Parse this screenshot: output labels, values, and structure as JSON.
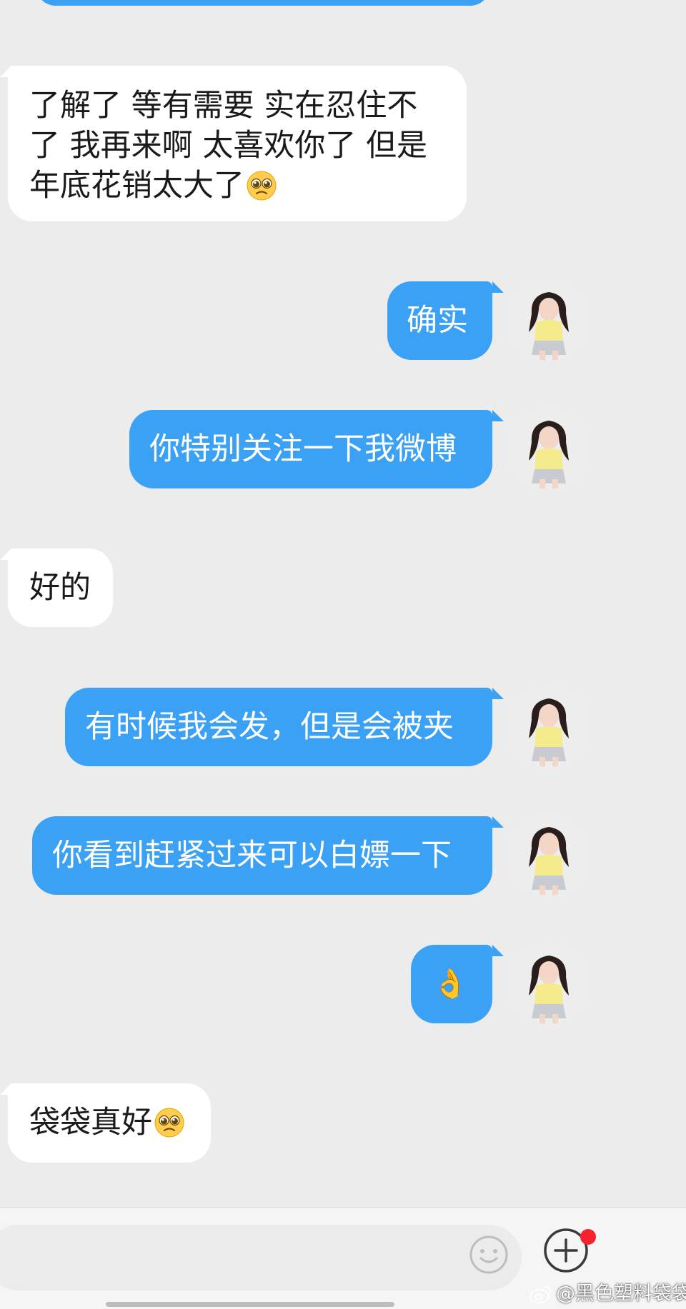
{
  "messages": [
    {
      "side": "incoming",
      "text": "了解了 等有需要 实在忍住不了 我再来啊 太喜欢你了 但是年底花销太大了",
      "emoji": "pleading-face"
    },
    {
      "side": "outgoing",
      "text": "确实"
    },
    {
      "side": "outgoing",
      "text": "你特别关注一下我微博"
    },
    {
      "side": "incoming",
      "text": "好的"
    },
    {
      "side": "outgoing",
      "text": "有时候我会发，但是会被夹"
    },
    {
      "side": "outgoing",
      "text": "你看到赶紧过来可以白嫖一下"
    },
    {
      "side": "outgoing",
      "text": "👌"
    },
    {
      "side": "incoming",
      "text": "袋袋真好",
      "emoji": "pleading-face"
    }
  ],
  "colors": {
    "background": "#ececec",
    "incoming_bubble": "#ffffff",
    "outgoing_bubble": "#3aa1f5",
    "notification_dot": "#f5222d"
  },
  "icons": {
    "emoji_button": "smiley-icon",
    "more_button": "plus-circle-icon",
    "avatar": "user-avatar"
  },
  "input": {
    "value": "",
    "placeholder": ""
  },
  "watermark": {
    "text": "@黑色塑料袋袋"
  }
}
